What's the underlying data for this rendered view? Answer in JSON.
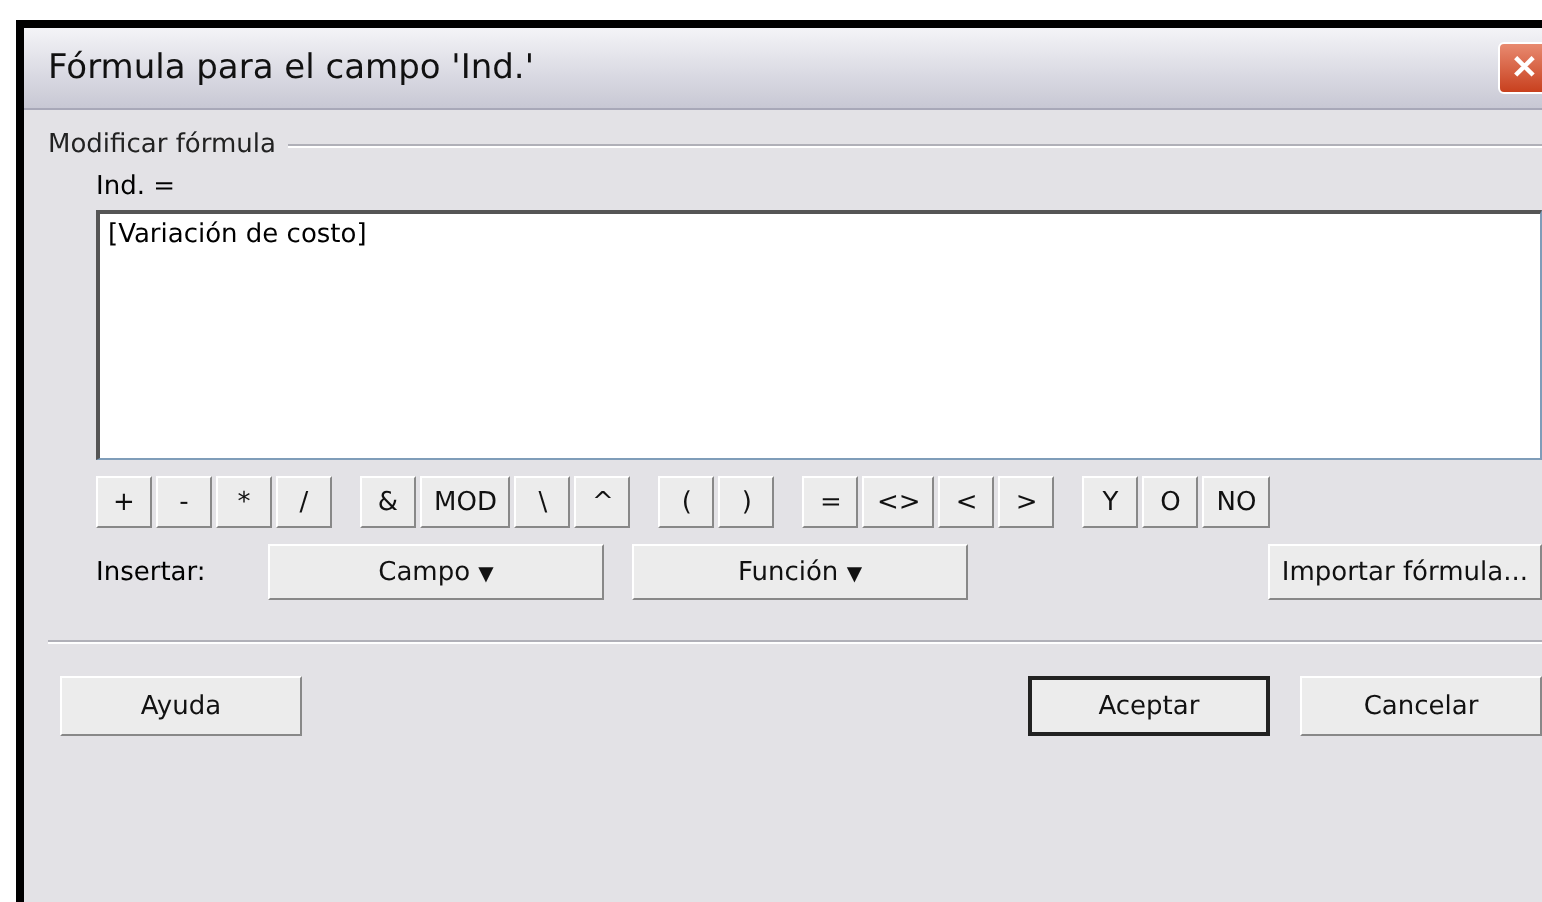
{
  "window": {
    "title": "Fórmula para el campo 'Ind.'",
    "close": "✕"
  },
  "group": {
    "label": "Modificar fórmula"
  },
  "formula": {
    "label": "Ind. =",
    "value": "[Variación de costo]"
  },
  "operator_groups": [
    [
      "+",
      "-",
      "*",
      "/"
    ],
    [
      "&",
      "MOD",
      "\\",
      "^"
    ],
    [
      "(",
      ")"
    ],
    [
      "=",
      "<>",
      "<",
      ">"
    ],
    [
      "Y",
      "O",
      "NO"
    ]
  ],
  "insert": {
    "label": "Insertar:",
    "menus": [
      {
        "label": "Campo",
        "caret": "▼"
      },
      {
        "label": "Función",
        "caret": "▼"
      }
    ],
    "import": "Importar fórmula..."
  },
  "buttons": [
    {
      "label": "Ayuda",
      "default": false
    },
    {
      "label": "Aceptar",
      "default": true
    },
    {
      "label": "Cancelar",
      "default": false
    }
  ]
}
